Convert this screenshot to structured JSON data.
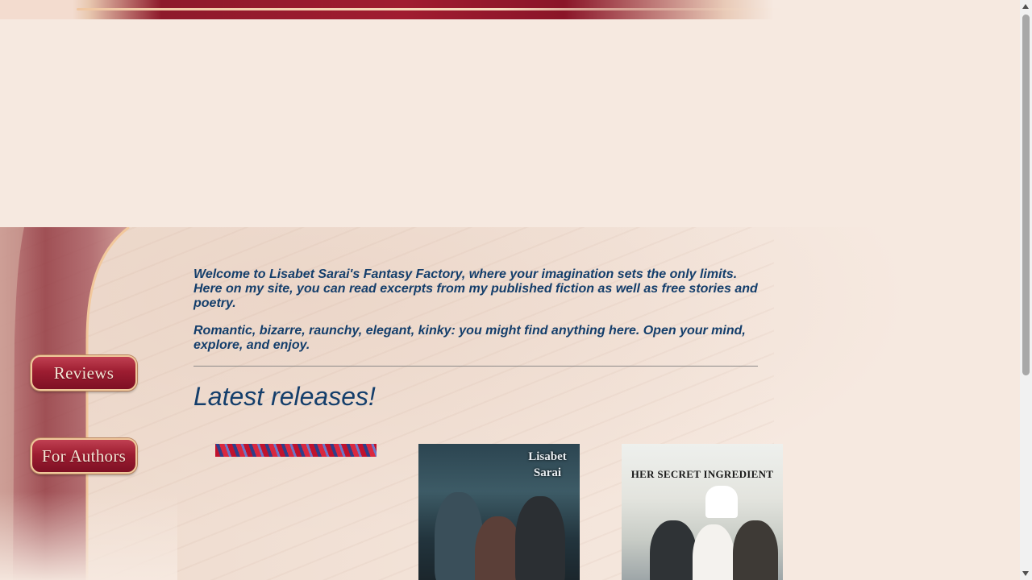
{
  "nav": {
    "reviews_label": "Reviews",
    "for_authors_label": "For Authors"
  },
  "welcome": {
    "paragraph1": "Welcome to Lisabet Sarai's Fantasy Factory, where your imagination sets the only limits. Here on my site, you can read excerpts from my published fiction as well as free stories and poetry.",
    "paragraph2": "Romantic, bizarre, raunchy, elegant, kinky: you might find anything here. Open your mind, explore, and enjoy."
  },
  "latest_releases": {
    "heading": "Latest releases!",
    "books": [
      {
        "cover_text": ""
      },
      {
        "cover_text": "Lisabet Sarai"
      },
      {
        "cover_text": "HER SECRET INGREDIENT"
      }
    ]
  },
  "colors": {
    "background": "#f6e9e0",
    "accent_burgundy": "#9d1d31",
    "text_blue": "#143e6b",
    "button_border_gold": "#f0c99c"
  }
}
